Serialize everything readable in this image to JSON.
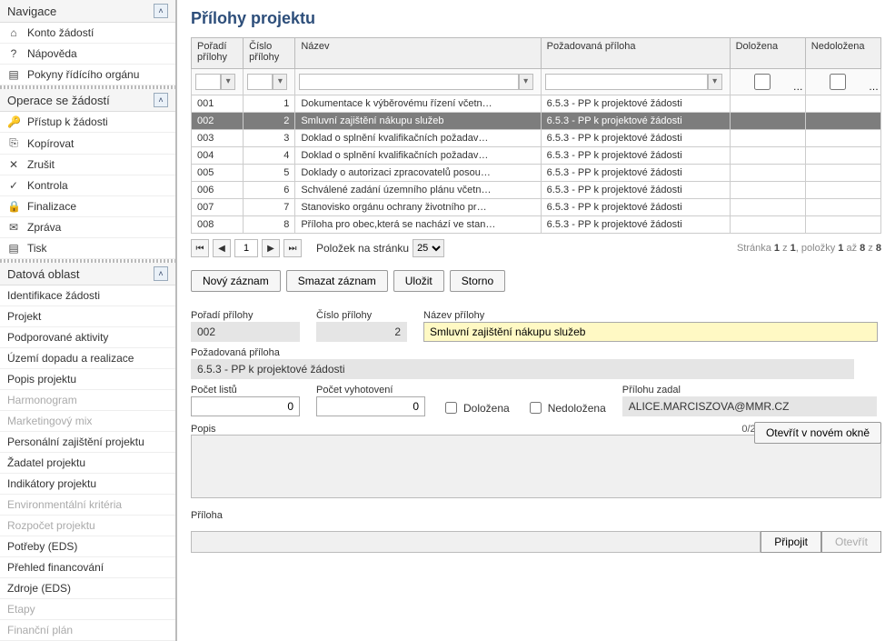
{
  "nav": {
    "groups": [
      {
        "title": "Navigace",
        "items": [
          {
            "icon": "⌂",
            "label": "Konto žádostí"
          },
          {
            "icon": "?",
            "label": "Nápověda"
          },
          {
            "icon": "▤",
            "label": "Pokyny řídícího orgánu"
          }
        ]
      },
      {
        "title": "Operace se žádostí",
        "items": [
          {
            "icon": "🔑",
            "label": "Přístup k žádosti"
          },
          {
            "icon": "⎘",
            "label": "Kopírovat"
          },
          {
            "icon": "✕",
            "label": "Zrušit"
          },
          {
            "icon": "✓",
            "label": "Kontrola"
          },
          {
            "icon": "🔒",
            "label": "Finalizace"
          },
          {
            "icon": "✉",
            "label": "Zpráva"
          },
          {
            "icon": "▤",
            "label": "Tisk"
          }
        ]
      },
      {
        "title": "Datová oblast",
        "items": [
          {
            "icon": "",
            "label": "Identifikace žádosti"
          },
          {
            "icon": "",
            "label": "Projekt"
          },
          {
            "icon": "",
            "label": "Podporované aktivity"
          },
          {
            "icon": "",
            "label": "Území dopadu a realizace"
          },
          {
            "icon": "",
            "label": "Popis projektu"
          },
          {
            "icon": "",
            "label": "Harmonogram",
            "disabled": true
          },
          {
            "icon": "",
            "label": "Marketingový mix",
            "disabled": true
          },
          {
            "icon": "",
            "label": "Personální zajištění projektu"
          },
          {
            "icon": "",
            "label": "Žadatel projektu"
          },
          {
            "icon": "",
            "label": "Indikátory projektu"
          },
          {
            "icon": "",
            "label": "Environmentální kritéria",
            "disabled": true
          },
          {
            "icon": "",
            "label": "Rozpočet projektu",
            "disabled": true
          },
          {
            "icon": "",
            "label": "Potřeby (EDS)"
          },
          {
            "icon": "",
            "label": "Přehled financování"
          },
          {
            "icon": "",
            "label": "Zdroje (EDS)"
          },
          {
            "icon": "",
            "label": "Etapy",
            "disabled": true
          },
          {
            "icon": "",
            "label": "Finanční plán",
            "disabled": true
          }
        ]
      }
    ]
  },
  "page": {
    "title": "Přílohy projektu"
  },
  "grid": {
    "cols": {
      "poradi": "Pořadí přílohy",
      "cislo": "Číslo přílohy",
      "nazev": "Název",
      "pozad": "Požadovaná příloha",
      "dolozena": "Doložena",
      "nedolozena": "Nedoložena"
    },
    "rows": [
      {
        "poradi": "001",
        "cislo": "1",
        "nazev": "Dokumentace k výběrovému řízení včetn…",
        "pozad": "6.5.3 - PP k projektové žádosti"
      },
      {
        "poradi": "002",
        "cislo": "2",
        "nazev": "Smluvní zajištění nákupu služeb",
        "pozad": "6.5.3 - PP k projektové žádosti",
        "selected": true
      },
      {
        "poradi": "003",
        "cislo": "3",
        "nazev": "Doklad o splnění kvalifikačních požadav…",
        "pozad": "6.5.3 - PP k projektové žádosti"
      },
      {
        "poradi": "004",
        "cislo": "4",
        "nazev": "Doklad o splnění kvalifikačních požadav…",
        "pozad": "6.5.3 - PP k projektové žádosti"
      },
      {
        "poradi": "005",
        "cislo": "5",
        "nazev": "Doklady o autorizaci zpracovatelů posou…",
        "pozad": "6.5.3 - PP k projektové žádosti"
      },
      {
        "poradi": "006",
        "cislo": "6",
        "nazev": "Schválené zadání územního plánu včetn…",
        "pozad": "6.5.3 - PP k projektové žádosti"
      },
      {
        "poradi": "007",
        "cislo": "7",
        "nazev": "Stanovisko orgánu ochrany životního pr…",
        "pozad": "6.5.3 - PP k projektové žádosti"
      },
      {
        "poradi": "008",
        "cislo": "8",
        "nazev": "Příloha pro obec,která se nachází ve stan…",
        "pozad": "6.5.3 - PP k projektové žádosti"
      }
    ]
  },
  "pager": {
    "page": "1",
    "sizeLabel": "Položek na stránku",
    "size": "25",
    "info_prefix": "Stránka ",
    "info_page": "1",
    "info_mid": " z ",
    "info_total": "1",
    "info_items_prefix": ", položky ",
    "info_from": "1",
    "info_to_mid": " až ",
    "info_to": "8",
    "info_of_mid": " z ",
    "info_of": "8"
  },
  "actions": {
    "new": "Nový záznam",
    "del": "Smazat záznam",
    "save": "Uložit",
    "storno": "Storno"
  },
  "form": {
    "labels": {
      "poradi": "Pořadí přílohy",
      "cislo": "Číslo přílohy",
      "nazev": "Název přílohy",
      "pozad": "Požadovaná příloha",
      "listu": "Počet listů",
      "vyhot": "Počet vyhotovení",
      "dolozena": "Doložena",
      "nedolozena": "Nedoložena",
      "zadal": "Přílohu zadal",
      "popis": "Popis",
      "priloha": "Příloha"
    },
    "values": {
      "poradi": "002",
      "cislo": "2",
      "nazev": "Smluvní zajištění nákupu služeb",
      "pozad": "6.5.3 - PP k projektové žádosti",
      "listu": "0",
      "vyhot": "0",
      "zadal": "ALICE.MARCISZOVA@MMR.CZ",
      "popis_count": "0/2000"
    },
    "buttons": {
      "open_new": "Otevřít v novém okně",
      "attach": "Připojit",
      "open": "Otevřít"
    }
  }
}
